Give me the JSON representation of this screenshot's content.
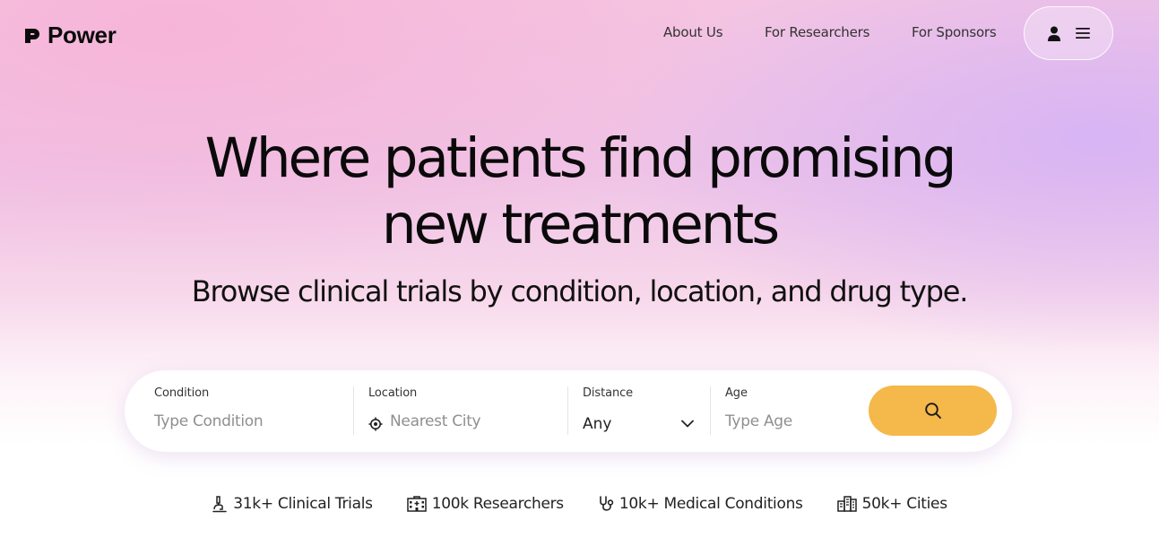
{
  "brand": {
    "name": "Power"
  },
  "nav": {
    "items": [
      "About Us",
      "For Researchers",
      "For Sponsors"
    ],
    "user_icon": "user-icon",
    "menu_icon": "hamburger-menu-icon"
  },
  "hero": {
    "title_line1": "Where patients find promising",
    "title_line2": "new treatments",
    "subtitle": "Browse clinical trials by condition, location, and drug type."
  },
  "search": {
    "condition": {
      "label": "Condition",
      "placeholder": "Type Condition"
    },
    "location": {
      "label": "Location",
      "placeholder": "Nearest City",
      "icon": "location-target-icon"
    },
    "distance": {
      "label": "Distance",
      "value": "Any",
      "icon": "chevron-down-icon"
    },
    "age": {
      "label": "Age",
      "placeholder": "Type Age"
    },
    "button_icon": "search-icon",
    "button_color": "#f5b84a"
  },
  "stats": [
    {
      "text": "31k+ Clinical Trials",
      "icon": "microscope-icon"
    },
    {
      "text": "100k Researchers",
      "icon": "hospital-icon"
    },
    {
      "text": "10k+ Medical Conditions",
      "icon": "stethoscope-icon"
    },
    {
      "text": "50k+ Cities",
      "icon": "city-buildings-icon"
    }
  ]
}
